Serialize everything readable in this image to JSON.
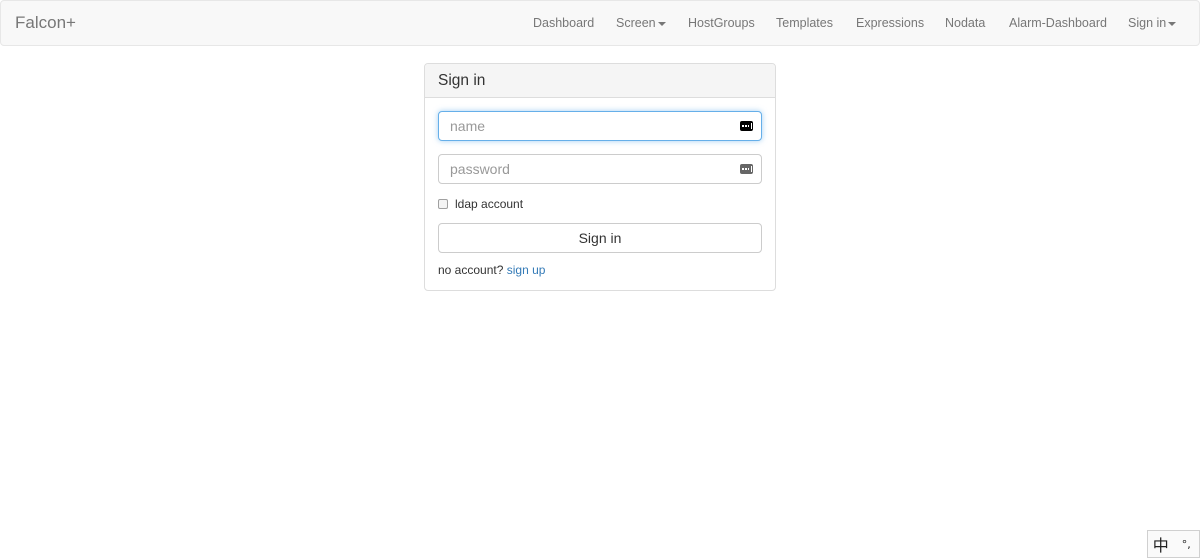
{
  "navbar": {
    "brand": "Falcon+",
    "items": [
      {
        "label": "Dashboard",
        "has_caret": false
      },
      {
        "label": "Screen",
        "has_caret": true
      },
      {
        "label": "HostGroups",
        "has_caret": false
      },
      {
        "label": "Templates",
        "has_caret": false
      },
      {
        "label": "Expressions",
        "has_caret": false
      },
      {
        "label": "Nodata",
        "has_caret": false
      },
      {
        "label": "Alarm-Dashboard",
        "has_caret": false
      },
      {
        "label": "Sign in",
        "has_caret": true
      }
    ]
  },
  "signin_panel": {
    "title": "Sign in",
    "name_field": {
      "value": "",
      "placeholder": "name",
      "icon": "password-manager-key-icon"
    },
    "password_field": {
      "value": "",
      "placeholder": "password",
      "icon": "password-manager-key-icon"
    },
    "ldap_checkbox": {
      "label": "ldap account",
      "checked": false
    },
    "submit_label": "Sign in",
    "no_account_text": "no account?",
    "signup_link": "sign up"
  },
  "ime_indicator": {
    "mode_char": "中",
    "punct_char": "°,"
  },
  "colors": {
    "navbar_bg": "#f8f8f8",
    "link": "#337ab7",
    "focus_border": "#66afe9"
  }
}
